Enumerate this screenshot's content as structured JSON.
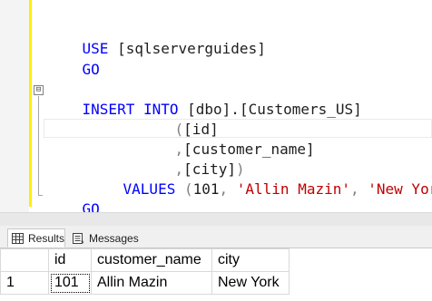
{
  "editor": {
    "fold_symbol": "⊟",
    "lines": {
      "l1": {
        "kw": "USE",
        "rest": " [sqlserverguides]"
      },
      "l2": {
        "kw": "GO"
      },
      "l3": {
        "kw1": "INSERT",
        "kw2": "INTO",
        "rest": "[dbo].[Customers_US]"
      },
      "l4": {
        "p": "(",
        "id": "[id]"
      },
      "l5": {
        "p": ",",
        "id": "[customer_name]"
      },
      "l6": {
        "p": ",",
        "id": "[city]",
        "close": ")"
      },
      "l7": {
        "kw": "VALUES",
        "open": " (",
        "num": "101",
        "c1": ", ",
        "s1": "'Allin Mazin'",
        "c2": ", ",
        "s2": "'New York'",
        "close": ")"
      },
      "l8": {
        "kw": "GO"
      }
    }
  },
  "tabs": [
    {
      "label": "Results",
      "icon": "grid-icon",
      "active": true
    },
    {
      "label": "Messages",
      "icon": "messages-icon",
      "active": false
    }
  ],
  "results": {
    "columns": [
      "id",
      "customer_name",
      "city"
    ],
    "rows": [
      {
        "num": "1",
        "cells": [
          "101",
          "Allin Mazin",
          "New York"
        ]
      }
    ]
  },
  "colors": {
    "keyword": "#0000ff",
    "string": "#c00000",
    "gray_punct": "#808080",
    "change_marker": "#ffef00"
  }
}
